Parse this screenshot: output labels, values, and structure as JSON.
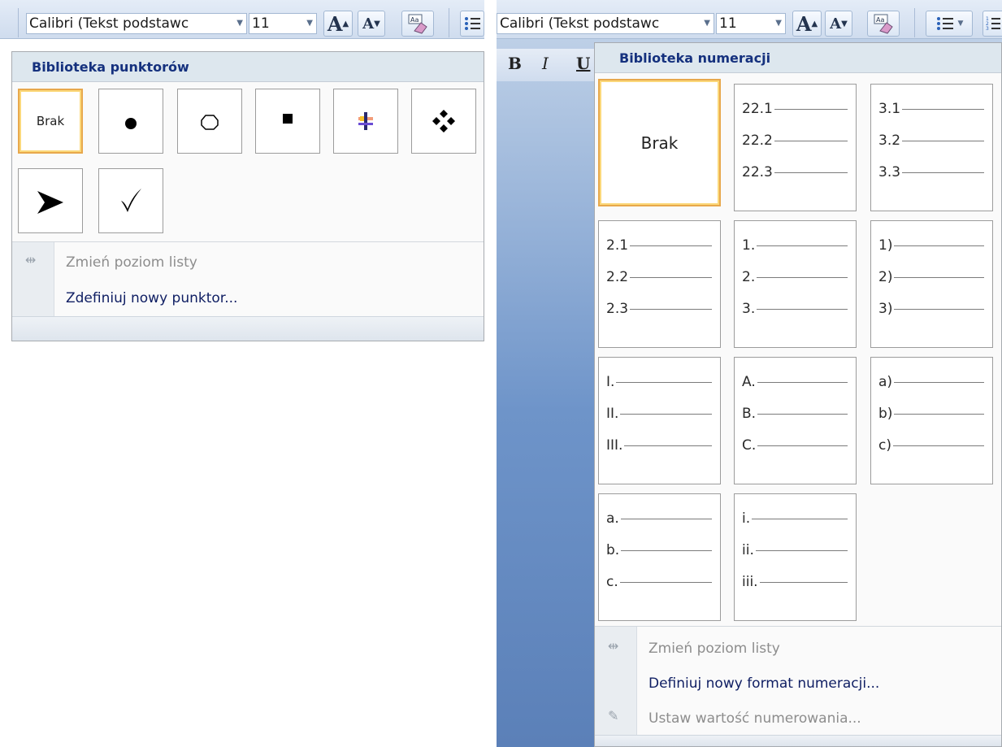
{
  "left_panel": {
    "toolbar": {
      "font_name": "Calibri (Tekst podstawc",
      "font_size": "11",
      "grow_font": "A",
      "shrink_font": "A"
    },
    "gallery_title": "Biblioteka punktorów",
    "bullets": [
      {
        "name": "Brak",
        "text": "Brak",
        "selected": true
      },
      {
        "name": "filled-circle",
        "glyph": "●"
      },
      {
        "name": "hollow-circle",
        "glyph": "○"
      },
      {
        "name": "filled-square",
        "glyph": "■"
      },
      {
        "name": "colored-cross",
        "glyph": "✚"
      },
      {
        "name": "four-diamonds",
        "glyph": "❖"
      },
      {
        "name": "arrowhead",
        "glyph": "➤"
      },
      {
        "name": "checkmark",
        "glyph": "✓"
      }
    ],
    "menu_items": {
      "change_level": "Zmień poziom listy",
      "define_bullet": "Zdefiniuj nowy punktor..."
    }
  },
  "right_panel": {
    "toolbar": {
      "font_name": "Calibri (Tekst podstawc",
      "font_size": "11",
      "grow_font": "A",
      "shrink_font": "A"
    },
    "format_bar": {
      "bold": "B",
      "italic": "I",
      "underline": "U"
    },
    "gallery_title": "Biblioteka numeracji",
    "none_label": "Brak",
    "formats": [
      {
        "name": "multilevel-22",
        "labels": [
          "22.1",
          "22.2",
          "22.3"
        ]
      },
      {
        "name": "multilevel-3",
        "labels": [
          "3.1",
          "3.2",
          "3.3"
        ]
      },
      {
        "name": "multilevel-2",
        "labels": [
          "2.1",
          "2.2",
          "2.3"
        ]
      },
      {
        "name": "decimal-dot",
        "labels": [
          "1.",
          "2.",
          "3."
        ]
      },
      {
        "name": "decimal-paren",
        "labels": [
          "1)",
          "2)",
          "3)"
        ]
      },
      {
        "name": "upper-roman",
        "labels": [
          "I.",
          "II.",
          "III."
        ]
      },
      {
        "name": "upper-alpha",
        "labels": [
          "A.",
          "B.",
          "C."
        ]
      },
      {
        "name": "lower-alpha-paren",
        "labels": [
          "a)",
          "b)",
          "c)"
        ]
      },
      {
        "name": "lower-alpha-dot",
        "labels": [
          "a.",
          "b.",
          "c."
        ]
      },
      {
        "name": "lower-roman",
        "labels": [
          "i.",
          "ii.",
          "iii."
        ]
      }
    ],
    "menu_items": {
      "change_level": "Zmień poziom listy",
      "define_format": "Definiuj nowy format numeracji...",
      "set_value": "Ustaw wartość numerowania..."
    }
  }
}
